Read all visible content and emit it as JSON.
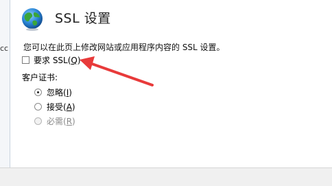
{
  "left_edge_text": "cc",
  "header": {
    "title": "SSL  设置"
  },
  "description": "您可以在此页上修改网站或应用程序内容的 SSL 设置。",
  "require_ssl": {
    "label_prefix": "要求 SSL(",
    "accel": "Q",
    "label_suffix": ")",
    "checked": false
  },
  "client_cert": {
    "label": "客户证书:",
    "options": [
      {
        "label": "忽略(",
        "accel": "I",
        "suffix": ")",
        "selected": true,
        "enabled": true
      },
      {
        "label": "接受(",
        "accel": "A",
        "suffix": ")",
        "selected": false,
        "enabled": true
      },
      {
        "label": "必需(",
        "accel": "R",
        "suffix": ")",
        "selected": false,
        "enabled": false
      }
    ]
  },
  "annotation": {
    "arrow_color": "#e83a3a"
  }
}
